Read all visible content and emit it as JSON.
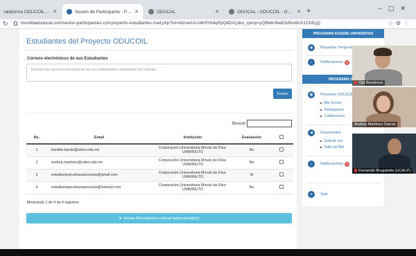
{
  "browser": {
    "tabs": [
      {
        "label": "lataforma ODUCOIL - Presenta"
      },
      {
        "label": "Sesión de Participante - Portal de"
      },
      {
        "label": "ODUCAL"
      },
      {
        "label": "ODUCAL - ODUCOIL - Guía de la"
      }
    ],
    "url": "movilidadoducal.com/sesion-participantes-coil-proyecto-estudiantes-mail.php?id=n6zvarUcU4K9YbdqPpQ6DA))&id_cproy=yQBk6U6a8Od5Iu6UX1CKEg))"
  },
  "page": {
    "title": "Estudiantes del Proyecto ODUCOIL",
    "emails_label": "Correos electrónicos de sus Estudiantes",
    "emails_placeholder": "Escriba los correos electrónicos de sus estudiantes separados por comas.",
    "send_label": "Enviar",
    "search_label": "Buscar:",
    "table": {
      "headers": [
        "No.",
        "Email",
        "Institución",
        "Evaluación"
      ],
      "rows": [
        {
          "no": "1",
          "email": "benilde.banda@uden.edu.mx",
          "institucion": "Corporación Universitaria Minuto de Dios-UNIMINUTO",
          "evaluacion": "No"
        },
        {
          "no": "2",
          "email": "andrea.martinez@uden.edu.mx",
          "institucion": "Corporación Universitaria Minuto de Dios-UNIMINUTO",
          "evaluacion": "No"
        },
        {
          "no": "3",
          "email": "estudiantepruebasasesorias@gmail.com",
          "institucion": "Corporación Universitaria Minuto de Dios-UNIMINUTO",
          "evaluacion": "Si"
        },
        {
          "no": "4",
          "email": "estudiantepruebasasesorias@hotmail.com",
          "institucion": "Corporación Universitaria Minuto de Dios-UNIMINUTO",
          "evaluacion": "No"
        }
      ]
    },
    "showing": "Mostrando 1 de 4 de 4 registros",
    "reminder_label": "Enviar Recordatorio a Email seleccionado(s)"
  },
  "sidebar": {
    "head1": "PROGRAMA AUGERE UNIVERSITAS",
    "pasantias": "Pasantías Temporales",
    "notificaciones1": "Notificaciones",
    "notif_badge1": "0",
    "head2": "PROGRAMA ODU",
    "proyectos": "Proyectos ODUCOIL",
    "mis_cursos": "Mis Cursos",
    "participacion": "Participación",
    "colaboracion": "Colaboración",
    "documentos": "Documentos",
    "guia": "Guía de uso",
    "taller": "Taller de Met",
    "notificaciones2": "Notificaciones",
    "notif_badge2": "0",
    "salir": "Salir"
  },
  "video": [
    {
      "name": "Yair Bonahora"
    },
    {
      "name": "Andrea Martinez Garcia"
    },
    {
      "name": "Fernando Brugaletta (UCALP)"
    }
  ]
}
